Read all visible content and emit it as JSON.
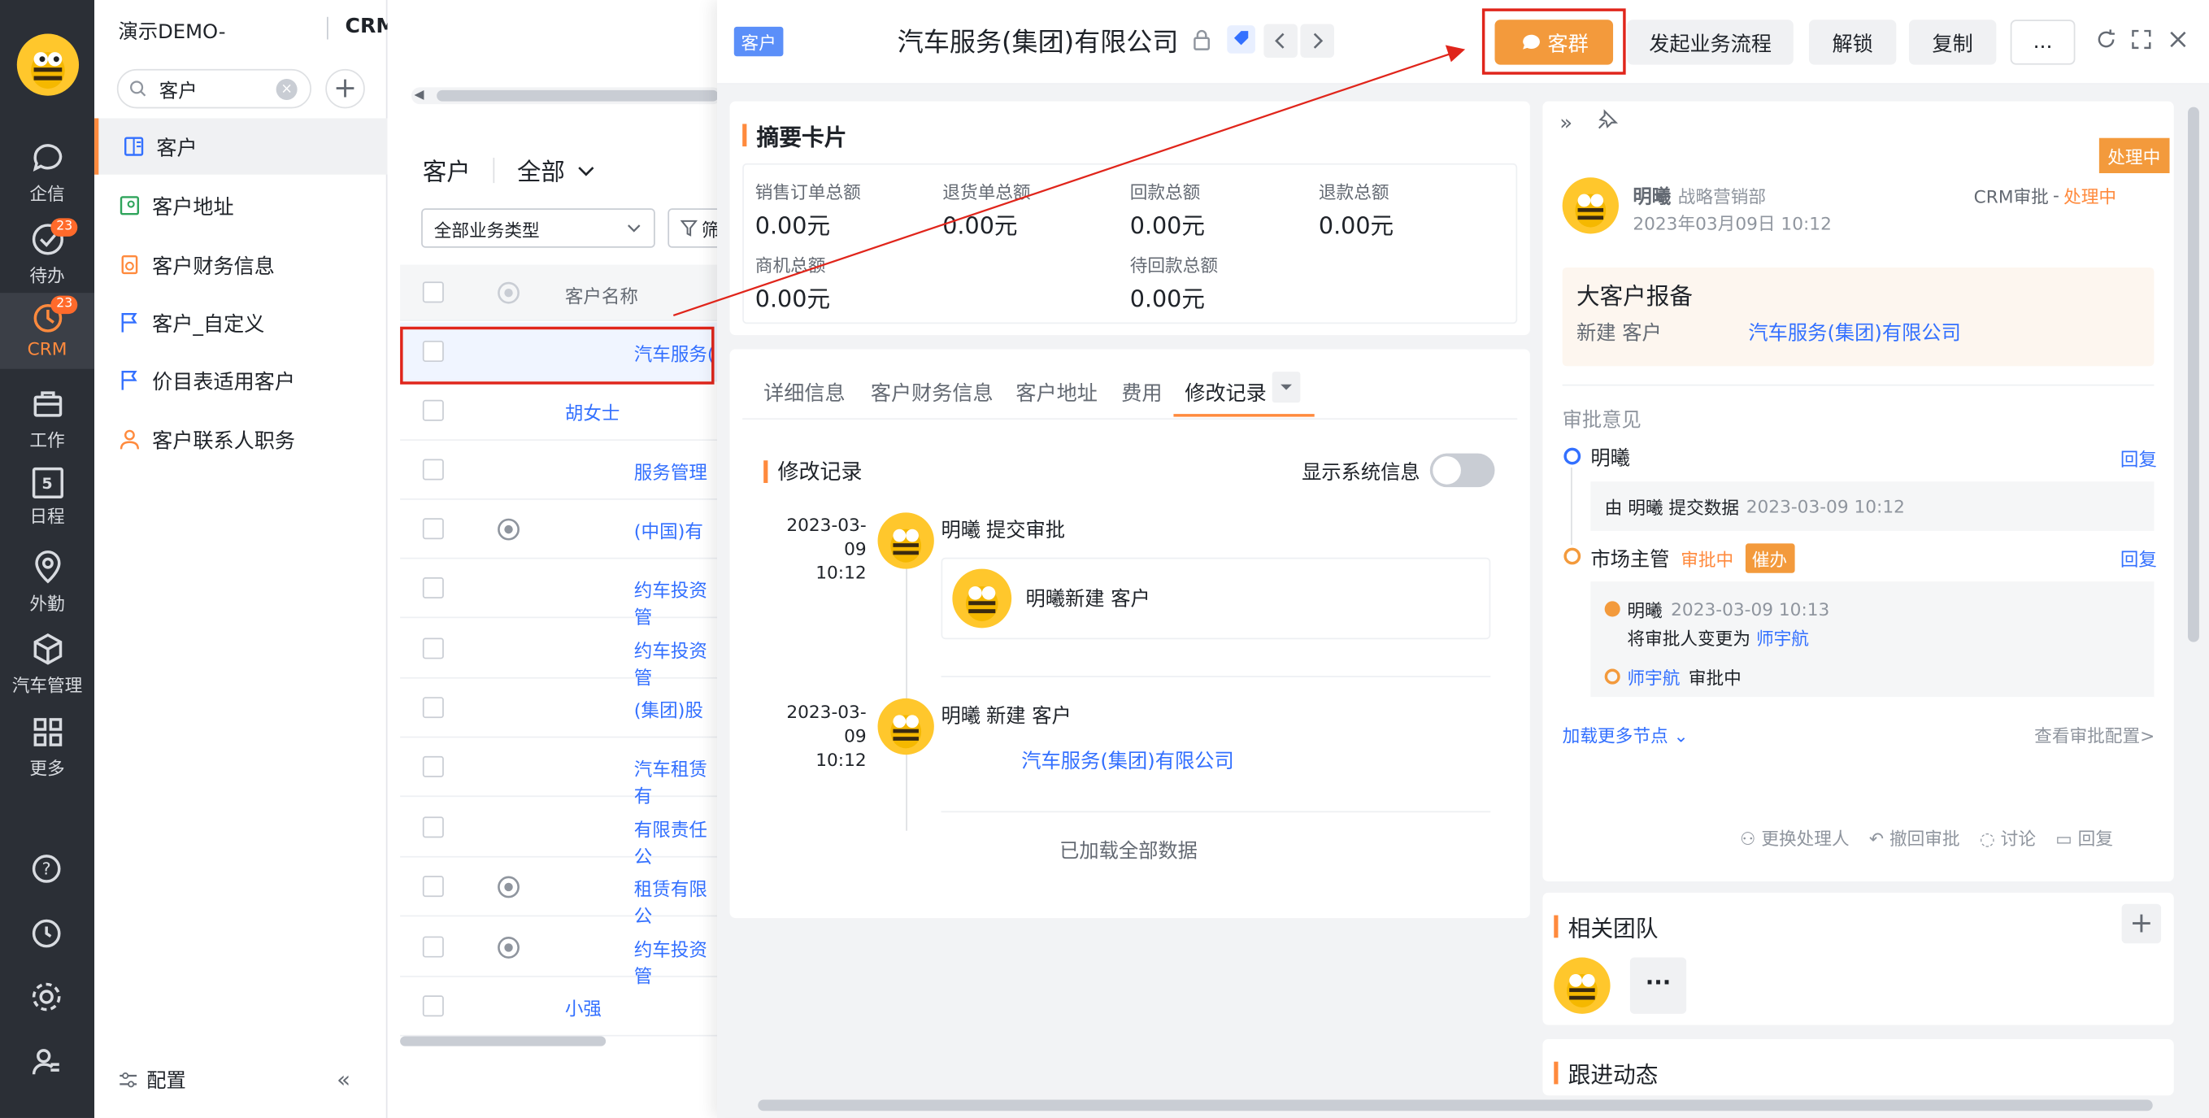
{
  "colors": {
    "accent": "#ff8a3d",
    "link": "#3370ff",
    "nav_bg": "#2b2f36",
    "highlight": "#e0251b"
  },
  "nav": {
    "items": [
      {
        "label": "企信",
        "icon": "chat-icon"
      },
      {
        "label": "待办",
        "icon": "check-circle-icon",
        "badge": "23"
      },
      {
        "label": "CRM",
        "icon": "crm-icon",
        "badge": "23"
      },
      {
        "label": "工作",
        "icon": "briefcase-icon"
      },
      {
        "label": "日程",
        "icon": "calendar-icon",
        "day": "5"
      },
      {
        "label": "外勤",
        "icon": "location-pin-icon"
      },
      {
        "label": "汽车管理",
        "icon": "cube-icon"
      },
      {
        "label": "更多",
        "icon": "grid-icon"
      }
    ]
  },
  "menu": {
    "org": "演示DEMO-",
    "module": "CRM",
    "search_value": "客户",
    "items": [
      "客户",
      "客户地址",
      "客户财务信息",
      "客户_自定义",
      "价目表适用客户",
      "客户联系人职务"
    ],
    "config_label": "配置"
  },
  "list": {
    "title": "客户",
    "scope": "全部",
    "filter_type": "全部业务类型",
    "filter_btn": "筛",
    "column": "客户名称",
    "rows": [
      {
        "name": "汽车服务(",
        "indent": true
      },
      {
        "name": "胡女士",
        "indent": false
      },
      {
        "name": "服务管理",
        "indent": true
      },
      {
        "name": "(中国)有",
        "indent": true
      },
      {
        "name": "约车投资管",
        "indent": true
      },
      {
        "name": "约车投资管",
        "indent": true
      },
      {
        "name": "(集团)股",
        "indent": true
      },
      {
        "name": "汽车租赁有",
        "indent": true
      },
      {
        "name": "有限责任公",
        "indent": true
      },
      {
        "name": "租赁有限公",
        "indent": true
      },
      {
        "name": "约车投资管",
        "indent": true
      },
      {
        "name": "小强",
        "indent": false
      }
    ]
  },
  "panel": {
    "tag": "客户",
    "title": "汽车服务(集团)有限公司",
    "buttons": {
      "group": "客群",
      "flow": "发起业务流程",
      "unlock": "解锁",
      "copy": "复制",
      "more": "..."
    },
    "summary": {
      "title": "摘要卡片",
      "stats": [
        {
          "label": "销售订单总额",
          "value": "0.00元"
        },
        {
          "label": "退货单总额",
          "value": "0.00元"
        },
        {
          "label": "回款总额",
          "value": "0.00元"
        },
        {
          "label": "退款总额",
          "value": "0.00元"
        },
        {
          "label": "商机总额",
          "value": "0.00元"
        },
        {
          "label": "待回款总额",
          "value": "0.00元"
        }
      ]
    },
    "tabs": [
      "详细信息",
      "客户财务信息",
      "客户地址",
      "费用",
      "修改记录"
    ],
    "log": {
      "title": "修改记录",
      "toggle_label": "显示系统信息",
      "entries": [
        {
          "date": "2023-03-09",
          "time": "10:12",
          "user": "明曦",
          "action": "提交审批",
          "detail": "明曦新建 客户"
        },
        {
          "date": "2023-03-09",
          "time": "10:12",
          "user": "明曦",
          "action": "新建 客户",
          "detail": "汽车服务(集团)有限公司"
        }
      ],
      "end": "已加载全部数据"
    },
    "approval": {
      "status": "处理中",
      "user": "明曦",
      "dept": "战略营销部",
      "datetime": "2023年03月09日 10:12",
      "flow_name": "CRM审批",
      "flow_status": "处理中",
      "box_title": "大客户报备",
      "box_label": "新建 客户",
      "box_value": "汽车服务(集团)有限公司",
      "opinion_title": "审批意见",
      "reply": "回复",
      "node1_user": "明曦",
      "node1_text": "由 明曦 提交数据",
      "node1_time": "2023-03-09 10:12",
      "node2_user": "市场主管",
      "node2_status": "审批中",
      "node2_urge": "催办",
      "node2_sub_user": "明曦",
      "node2_sub_time": "2023-03-09 10:13",
      "node2_change_text": "将审批人变更为",
      "node2_change_to": "师宇航",
      "node2_approver": "师宇航",
      "node2_approver_status": "审批中",
      "load_more": "加载更多节点",
      "view_config": "查看审批配置>",
      "actions": [
        "更换处理人",
        "撤回审批",
        "讨论",
        "回复"
      ]
    },
    "team_title": "相关团队",
    "follow_title": "跟进动态"
  }
}
